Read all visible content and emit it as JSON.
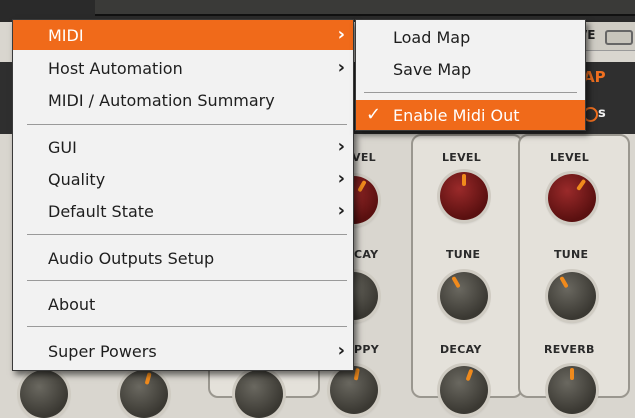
{
  "background": {
    "top_right_label": "VE",
    "header_label": "AP",
    "unit_label": "s",
    "columns": [
      {
        "labels": [
          "VEL",
          "CAY",
          "PPY"
        ]
      },
      {
        "labels": [
          "LEVEL",
          "TUNE",
          "DECAY"
        ]
      },
      {
        "labels": [
          "LEVEL",
          "TUNE",
          "REVERB"
        ]
      }
    ]
  },
  "main_menu": {
    "items": [
      {
        "label": "MIDI",
        "submenu": true
      },
      {
        "label": "Host Automation",
        "submenu": true
      },
      {
        "label": "MIDI / Automation Summary",
        "submenu": false
      },
      {
        "label": "GUI",
        "submenu": true
      },
      {
        "label": "Quality",
        "submenu": true
      },
      {
        "label": "Default State",
        "submenu": true
      },
      {
        "label": "Audio Outputs Setup",
        "submenu": false
      },
      {
        "label": "About",
        "submenu": false
      },
      {
        "label": "Super Powers",
        "submenu": true
      }
    ],
    "chevron": "›"
  },
  "midi_submenu": {
    "items": [
      {
        "label": "Load Map"
      },
      {
        "label": "Save Map"
      },
      {
        "label": "Enable Midi Out",
        "checked": true
      }
    ],
    "check_glyph": "✓"
  },
  "colors": {
    "accent": "#f06a1a",
    "knob_red": "#7a1a1a",
    "knob_grey": "#4a4840",
    "indicator": "#f08a1c"
  }
}
